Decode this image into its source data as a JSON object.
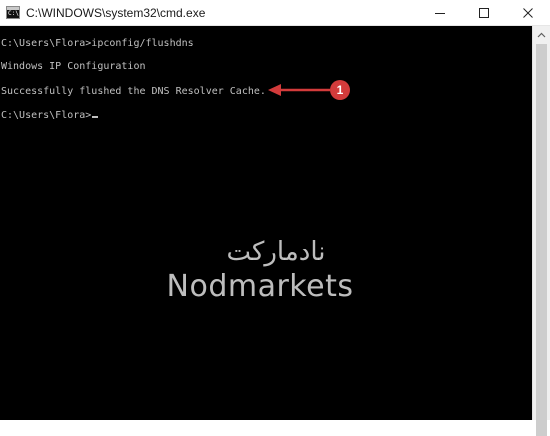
{
  "window": {
    "title": "C:\\WINDOWS\\system32\\cmd.exe",
    "app_icon": "cmd-icon",
    "app_icon_text": "C:\\",
    "controls": {
      "minimize_icon": "minimize-icon",
      "maximize_icon": "maximize-icon",
      "close_icon": "close-icon"
    }
  },
  "console": {
    "background": "#000000",
    "text_color": "#c0c0c0",
    "lines": [
      "C:\\Users\\Flora>ipconfig/flushdns",
      "Windows IP Configuration",
      "Successfully flushed the DNS Resolver Cache.",
      "C:\\Users\\Flora>"
    ]
  },
  "annotation": {
    "badge": "1",
    "color": "#d33b3b"
  },
  "watermark": {
    "arabic": "نادمارکت",
    "latin": "Nodmarkets"
  }
}
